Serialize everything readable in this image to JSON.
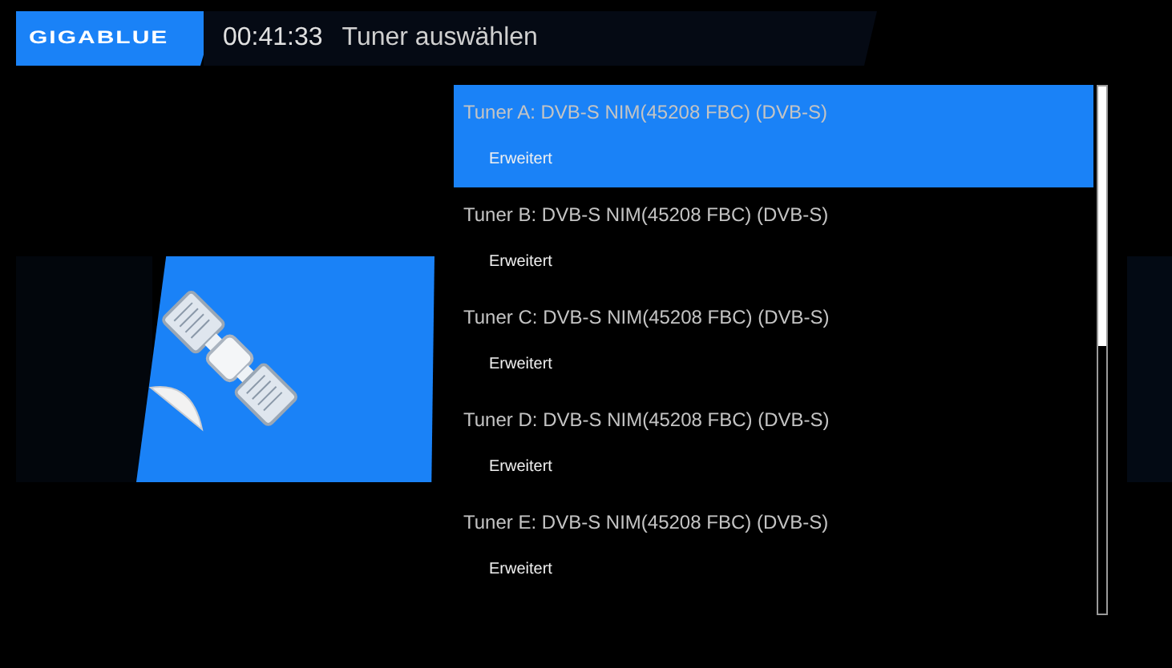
{
  "header": {
    "logo": "GIGABLUE",
    "time": "00:41:33",
    "title": "Tuner auswählen"
  },
  "tuners": [
    {
      "name": "Tuner A: DVB-S NIM(45208 FBC) (DVB-S)",
      "mode": "Erweitert",
      "selected": true
    },
    {
      "name": "Tuner B: DVB-S NIM(45208 FBC) (DVB-S)",
      "mode": "Erweitert",
      "selected": false
    },
    {
      "name": "Tuner C: DVB-S NIM(45208 FBC) (DVB-S)",
      "mode": "Erweitert",
      "selected": false
    },
    {
      "name": "Tuner D: DVB-S NIM(45208 FBC) (DVB-S)",
      "mode": "Erweitert",
      "selected": false
    },
    {
      "name": "Tuner E: DVB-S NIM(45208 FBC) (DVB-S)",
      "mode": "Erweitert",
      "selected": false
    }
  ]
}
